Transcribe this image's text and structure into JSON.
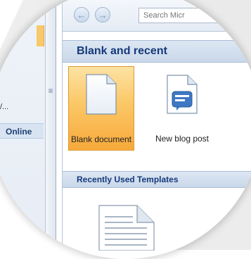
{
  "left_pane": {
    "ellipsis_text": "/...",
    "online_label": "Online"
  },
  "toolbar": {
    "back_label": "←",
    "forward_label": "→",
    "search_placeholder": "Search Micr"
  },
  "sections": {
    "blank_and_recent": "Blank and recent",
    "recently_used_templates": "Recently Used Templates"
  },
  "tiles": [
    {
      "label": "Blank document",
      "icon": "blank-document-icon",
      "selected": true
    },
    {
      "label": "New blog post",
      "icon": "blog-post-icon",
      "selected": false
    }
  ],
  "colors": {
    "selected_tile": "#f8a93b",
    "header_text": "#15397a",
    "header_bg": "#c9d8ea"
  }
}
